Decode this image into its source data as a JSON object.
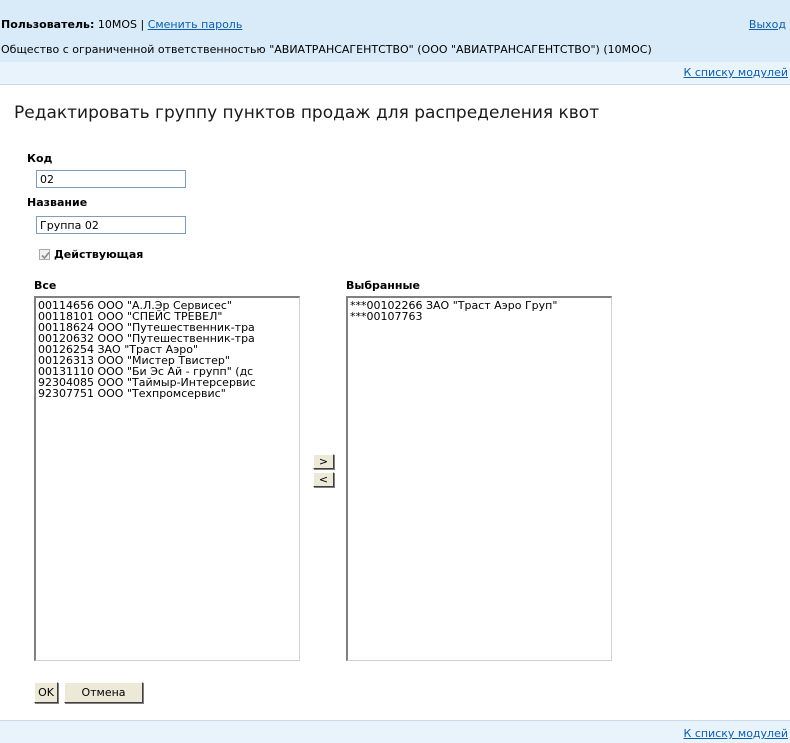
{
  "header": {
    "user_label": "Пользователь:",
    "user_value": " 10MOS | ",
    "change_password": "Сменить пароль",
    "exit": "Выход",
    "organization": "Общество с ограниченной ответственностью \"АВИАТРАНСАГЕНТСТВО\" (ООО \"АВИАТРАНСАГЕНТСТВО\") (10МОС)",
    "modules_link": "К списку модулей"
  },
  "page_title": "Редактировать группу пунктов продаж для распределения квот",
  "form": {
    "code_label": "Код",
    "code_value": "02",
    "name_label": "Название",
    "name_value": "Группа 02",
    "active_label": "Действующая",
    "active_checked": true
  },
  "lists": {
    "all_label": "Все",
    "selected_label": "Выбранные",
    "all_items": [
      "00114656 ООО \"А.Л.Эр Сервисес\"",
      "00118101 ООО \"СПЕЙС ТРЕВЕЛ\"",
      "00118624 ООО \"Путешественник-тра",
      "00120632 ООО \"Путешественник-тра",
      "00126254 ЗАО \"Траст Аэро\"",
      "00126313 ООО \"Мистер Твистер\"",
      "00131110 ООО \"Би Эс Ай - групп\" (дс",
      "92304085 ООО \"Таймыр-Интерсервис",
      "92307751 ООО \"Техпромсервис\""
    ],
    "selected_items": [
      "***00102266 ЗАО \"Траст Аэро Груп\"",
      "***00107763"
    ],
    "move_right": ">",
    "move_left": "<"
  },
  "buttons": {
    "ok": "OK",
    "cancel": "Отмена"
  },
  "footer": {
    "modules_link": "К списку модулей"
  },
  "colors": {
    "header_bg": "#d9ebf8",
    "subheader_bg": "#e9f3fb",
    "link": "#0b5fa8",
    "button_face": "#ece9d8"
  }
}
